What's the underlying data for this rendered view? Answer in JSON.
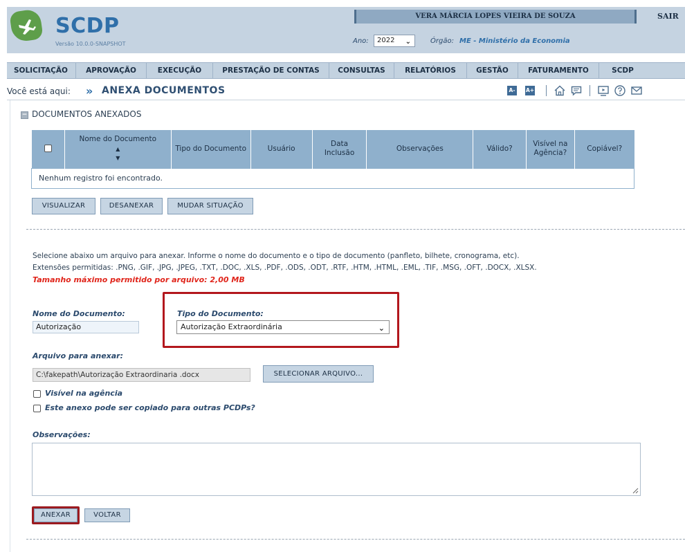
{
  "header": {
    "logo_text": "SCDP",
    "version": "Versão 10.0.0-SNAPSHOT",
    "user_name": "VERA MÁRCIA LOPES VIEIRA DE SOUZA",
    "logout_label": "SAIR",
    "year_label": "Ano:",
    "year_value": "2022",
    "org_label": "Órgão:",
    "org_value": "ME - Ministério da Economia"
  },
  "nav": {
    "items": [
      {
        "label": "SOLICITAÇÃO"
      },
      {
        "label": "APROVAÇÃO"
      },
      {
        "label": "EXECUÇÃO"
      },
      {
        "label": "PRESTAÇÃO DE CONTAS"
      },
      {
        "label": "CONSULTAS"
      },
      {
        "label": "RELATÓRIOS"
      },
      {
        "label": "GESTÃO"
      },
      {
        "label": "FATURAMENTO"
      },
      {
        "label": "SCDP"
      }
    ]
  },
  "breadcrumb": {
    "prefix": "Você está aqui:",
    "title": "ANEXA DOCUMENTOS",
    "font_decrease": "A-",
    "font_increase": "A+"
  },
  "attached": {
    "section_title": "DOCUMENTOS ANEXADOS",
    "columns": [
      "Nome do Documento",
      "Tipo do Documento",
      "Usuário",
      "Data Inclusão",
      "Observações",
      "Válido?",
      "Visível na Agência?",
      "Copiável?"
    ],
    "empty_message": "Nenhum registro foi encontrado.",
    "buttons": {
      "view": "VISUALIZAR",
      "detach": "DESANEXAR",
      "change_status": "MUDAR SITUAÇÃO"
    }
  },
  "upload": {
    "instruction": "Selecione abaixo um arquivo para anexar. Informe o nome do documento e o tipo de documento (panfleto, bilhete, cronograma, etc).",
    "extensions": "Extensões permitidas: .PNG, .GIF, .JPG, .JPEG, .TXT, .DOC, .XLS, .PDF, .ODS, .ODT, .RTF, .HTM, .HTML, .EML, .TIF, .MSG, .OFT, .DOCX, .XLSX.",
    "max_size": "Tamanho máximo permitido por arquivo: 2,00 MB",
    "doc_name_label": "Nome do Documento:",
    "doc_name_value": "Autorização",
    "doc_type_label": "Tipo do Documento:",
    "doc_type_value": "Autorização Extraordinária",
    "file_label": "Arquivo para anexar:",
    "file_value": "C:\\fakepath\\Autorização Extraordinaria .docx",
    "select_file_button": "SELECIONAR ARQUIVO...",
    "visible_agency_label": "Visível na agência",
    "copyable_label": "Este anexo pode ser copiado para outras PCDPs?",
    "observations_label": "Observações:",
    "observations_value": "",
    "attach_button": "ANEXAR",
    "back_button": "VOLTAR"
  },
  "colors": {
    "header_bg": "#c5d3e1",
    "table_header_bg": "#8fb0cc",
    "accent_blue": "#2f6fa9",
    "warning_red": "#e0251b",
    "highlight_red": "#b3171d"
  },
  "icons": [
    "plane-icon",
    "chevron-down-icon",
    "home-icon",
    "comment-icon",
    "presentation-icon",
    "help-icon",
    "mail-icon",
    "sort-icon",
    "collapse-icon",
    "checkbox-icon",
    "resize-grip-icon"
  ]
}
